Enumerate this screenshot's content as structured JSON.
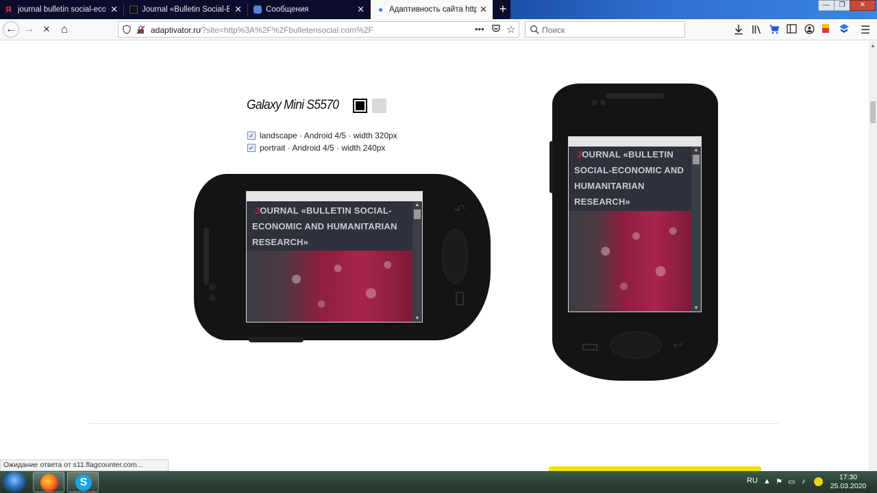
{
  "tabs": [
    {
      "title": "journal bulletin social-econom",
      "favicon": "yandex-icon",
      "active": false
    },
    {
      "title": "Journal «Bulletin Social-Econo",
      "favicon": "journal-site-icon",
      "active": false
    },
    {
      "title": "Сообщения",
      "favicon": "messages-icon",
      "active": false
    },
    {
      "title": "Адаптивность сайта http://bul",
      "favicon": "loading-dot-icon",
      "active": true
    }
  ],
  "new_tab_label": "+",
  "window_controls": {
    "minimize": "—",
    "restore": "❐",
    "close": "✕"
  },
  "nav": {
    "back": "←",
    "forward": "→",
    "stop": "✕",
    "home": "⌂"
  },
  "address": {
    "domain": "adaptivator.ru",
    "rest": "/?site=http%3A%2F%2Fbulletensocial.com%2F"
  },
  "search": {
    "placeholder": "Поиск"
  },
  "toolbar_icons": [
    "download-icon",
    "library-icon",
    "cart-icon",
    "sidebar-icon",
    "account-icon",
    "bookmark-flag-icon",
    "shield-extension-icon",
    "menu-icon"
  ],
  "device": {
    "name": "Galaxy Mini S5570",
    "color_options": [
      "black",
      "gray"
    ],
    "selected_color": "black",
    "options": [
      {
        "label": "landscape · Android 4/5 · width 320px",
        "checked": true
      },
      {
        "label": "portrait · Android 4/5 · width 240px",
        "checked": true
      }
    ]
  },
  "preview": {
    "landscape": {
      "heading_first": "J",
      "heading_rest": "OURNAL «BULLETIN SOCIAL-ECONOMIC AND HUMANITARIAN RESEARCH»"
    },
    "portrait": {
      "heading_first": "J",
      "heading_rest": "OURNAL «BULLETIN SOCIAL-ECONOMIC AND HUMANITARIAN RESEARCH»"
    }
  },
  "status_text": "Ожидание ответа от s11.flagcounter.com...",
  "taskbar": {
    "apps": [
      "firefox-icon",
      "skype-icon"
    ],
    "lang": "RU",
    "time": "17:30",
    "date": "25.03.2020"
  },
  "colors": {
    "accent_red": "#d0213a",
    "yellow_button": "#f1e300"
  }
}
